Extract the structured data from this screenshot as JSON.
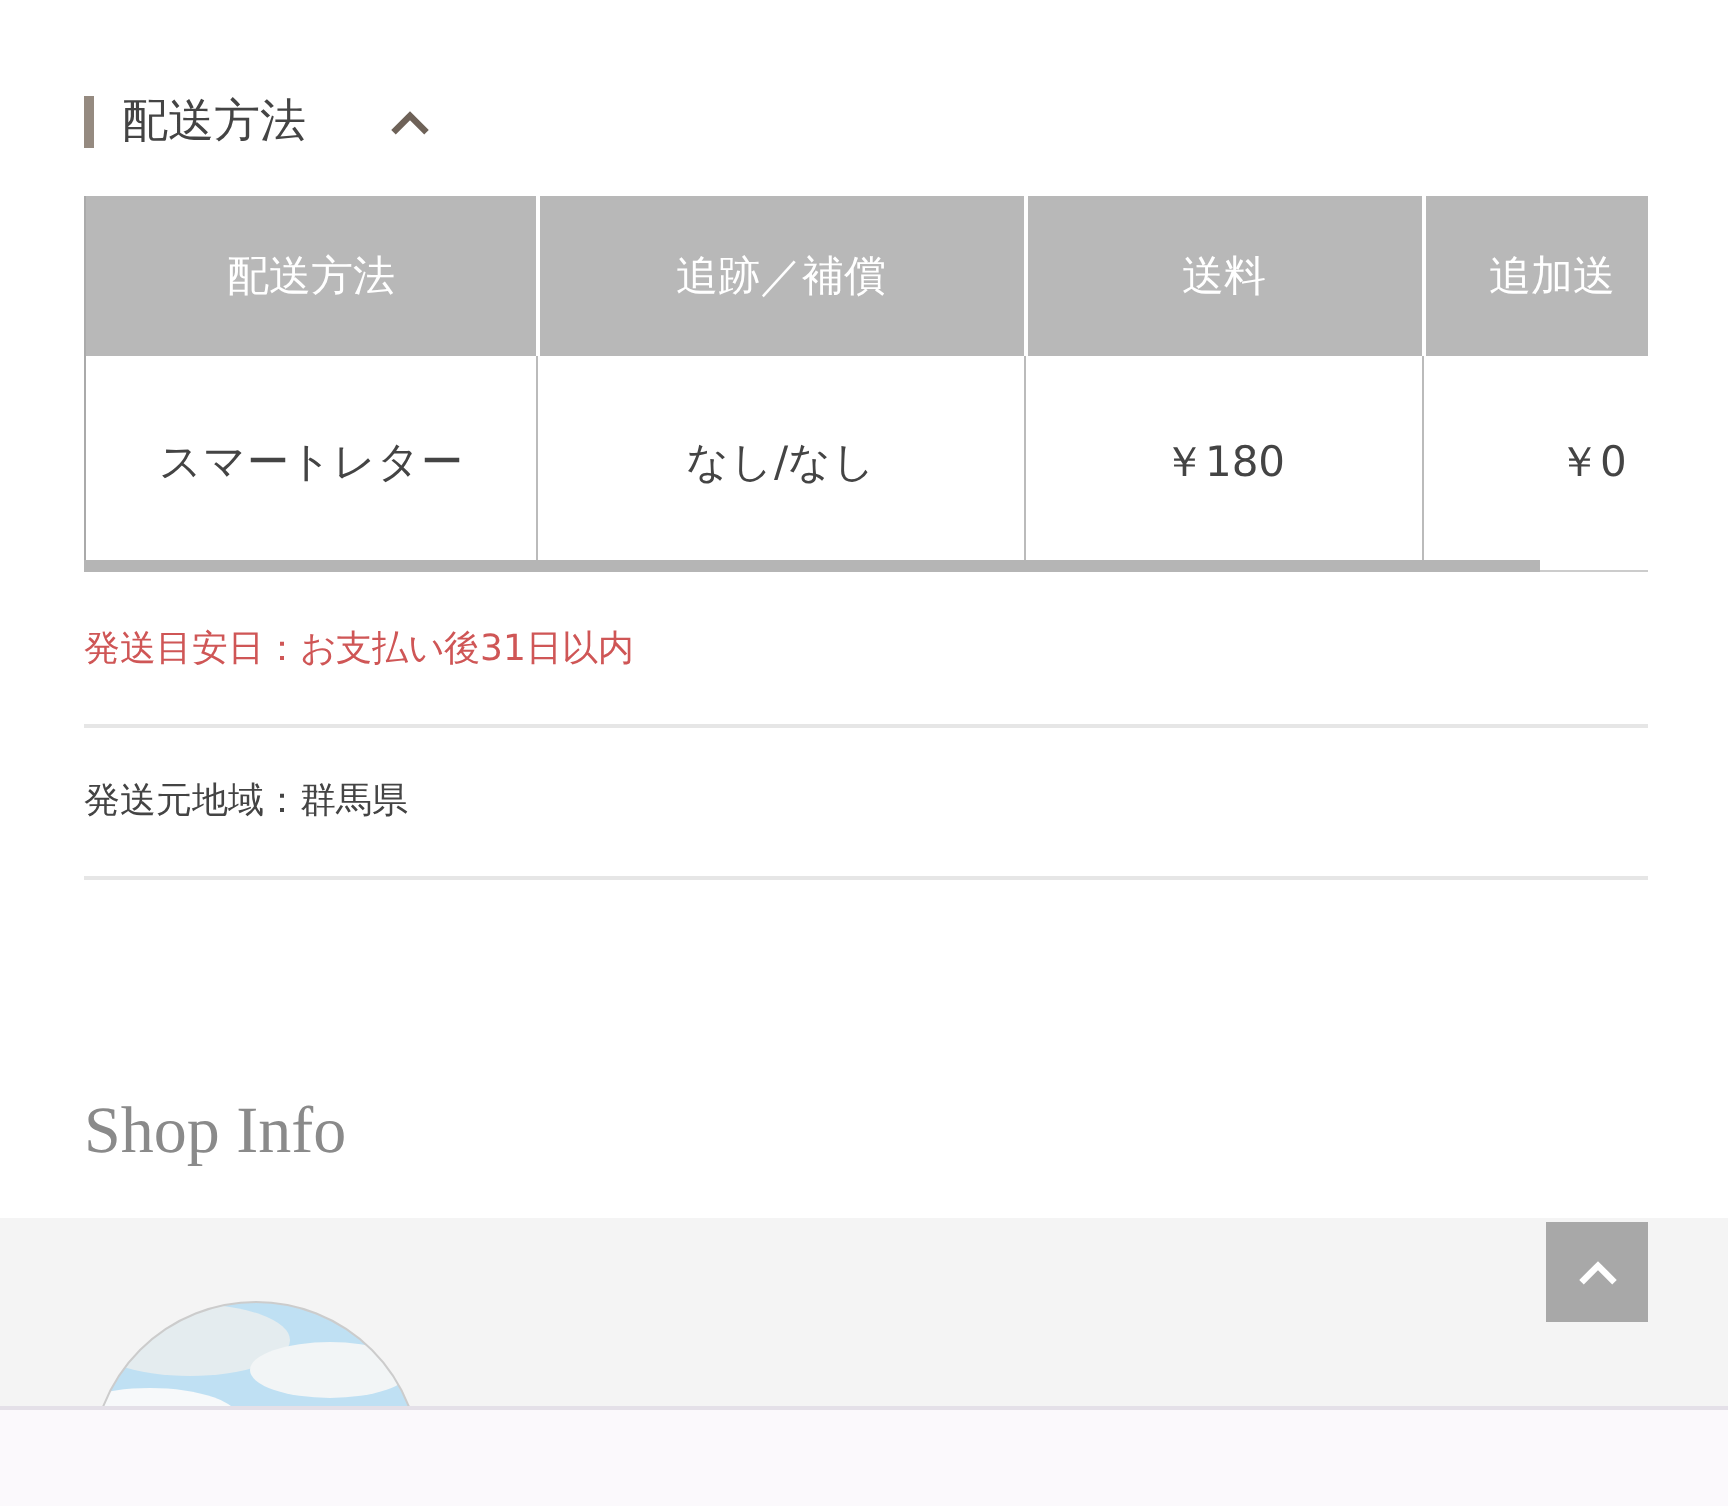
{
  "section": {
    "title": "配送方法",
    "expanded": true
  },
  "table": {
    "columns": [
      "配送方法",
      "追跡／補償",
      "送料",
      "追加送"
    ],
    "rows": [
      [
        "スマートレター",
        "なし/なし",
        "￥180",
        "￥0"
      ]
    ]
  },
  "shipping_estimate": "発送目安日：お支払い後31日以内",
  "origin": "発送元地域：群馬県",
  "shop_info": {
    "title": "Shop Info"
  }
}
